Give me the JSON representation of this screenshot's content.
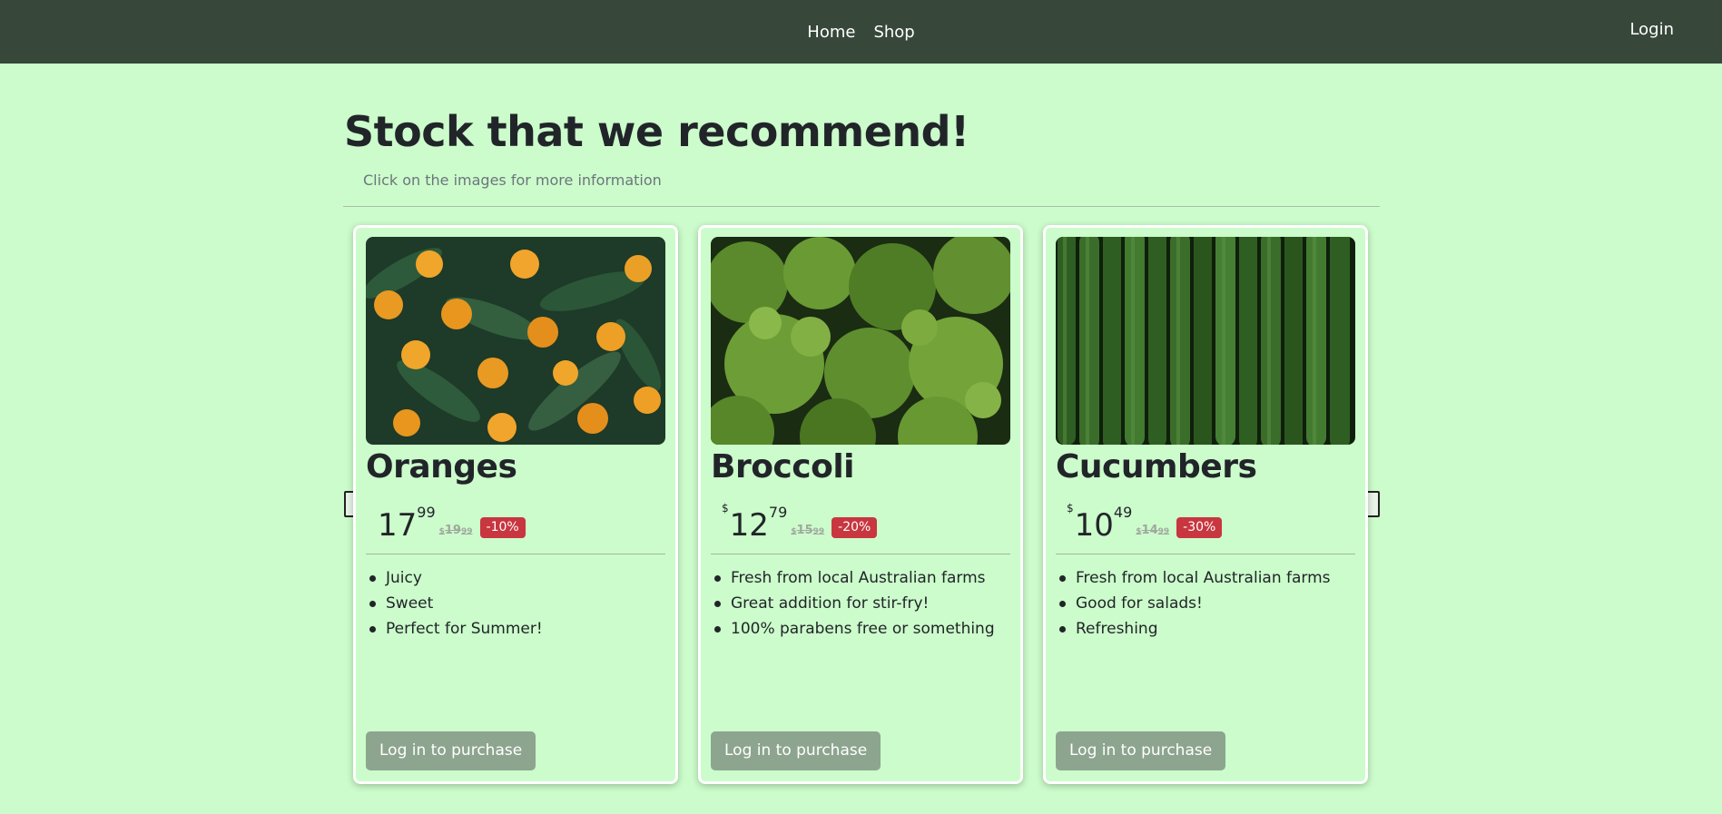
{
  "nav": {
    "links": [
      "Home",
      "Shop"
    ],
    "login": "Login"
  },
  "page": {
    "title": "Stock that we recommend!",
    "subtitle": "Click on the images for more information"
  },
  "carousel": {
    "prev_icon": "arrow-left-icon",
    "next_icon": "arrow-right-icon"
  },
  "products": [
    {
      "name": "Oranges",
      "currency": "",
      "price_main": "17",
      "price_cents": "99",
      "old_currency": "$",
      "old_main": "19",
      "old_cents": "99",
      "discount": "-10%",
      "features": [
        "Juicy",
        "Sweet",
        "Perfect for Summer!"
      ],
      "button": "Log in to purchase"
    },
    {
      "name": "Broccoli",
      "currency": "$",
      "price_main": "12",
      "price_cents": "79",
      "old_currency": "$",
      "old_main": "15",
      "old_cents": "99",
      "discount": "-20%",
      "features": [
        "Fresh from local Australian farms",
        "Great addition for stir-fry!",
        "100% parabens free or something"
      ],
      "button": "Log in to purchase"
    },
    {
      "name": "Cucumbers",
      "currency": "$",
      "price_main": "10",
      "price_cents": "49",
      "old_currency": "$",
      "old_main": "14",
      "old_cents": "99",
      "discount": "-30%",
      "features": [
        "Fresh from local Australian farms",
        "Good for salads!",
        "Refreshing"
      ],
      "button": "Log in to purchase"
    }
  ],
  "colors": {
    "background": "#ccfccb",
    "navbar": "#37483b",
    "badge": "#c8363f",
    "button": "#8da58f"
  }
}
